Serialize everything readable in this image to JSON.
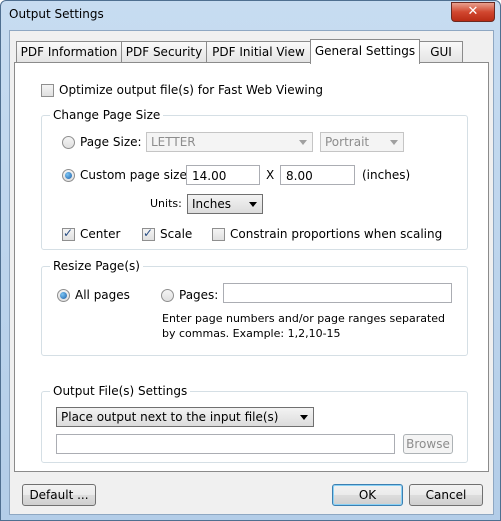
{
  "window": {
    "title": "Output Settings",
    "close_label": "✕"
  },
  "tabs": [
    {
      "label": "PDF Information"
    },
    {
      "label": "PDF Security"
    },
    {
      "label": "PDF Initial View"
    },
    {
      "label": "General Settings"
    },
    {
      "label": "GUI"
    }
  ],
  "general": {
    "fast_web_label": "Optimize output file(s) for Fast Web Viewing",
    "change_page_size": {
      "title": "Change Page Size",
      "page_size_label": "Page Size:",
      "page_size_value": "LETTER",
      "orientation_value": "Portrait",
      "custom_label": "Custom page size:",
      "width_value": "14.00",
      "x_label": "X",
      "height_value": "8.00",
      "unit_suffix": "(inches)",
      "units_label": "Units:",
      "units_value": "Inches",
      "center_label": "Center",
      "scale_label": "Scale",
      "constrain_label": "Constrain proportions when scaling"
    },
    "resize_pages": {
      "title": "Resize Page(s)",
      "all_pages_label": "All pages",
      "pages_label": "Pages:",
      "pages_value": "",
      "hint_line1": "Enter page numbers and/or page ranges separated",
      "hint_line2": "by commas. Example: 1,2,10-15"
    },
    "output_files": {
      "title": "Output File(s) Settings",
      "location_value": "Place output next to the input file(s)",
      "path_value": "",
      "browse_label": "Browse"
    }
  },
  "footer": {
    "default_label": "Default ...",
    "ok_label": "OK",
    "cancel_label": "Cancel"
  }
}
